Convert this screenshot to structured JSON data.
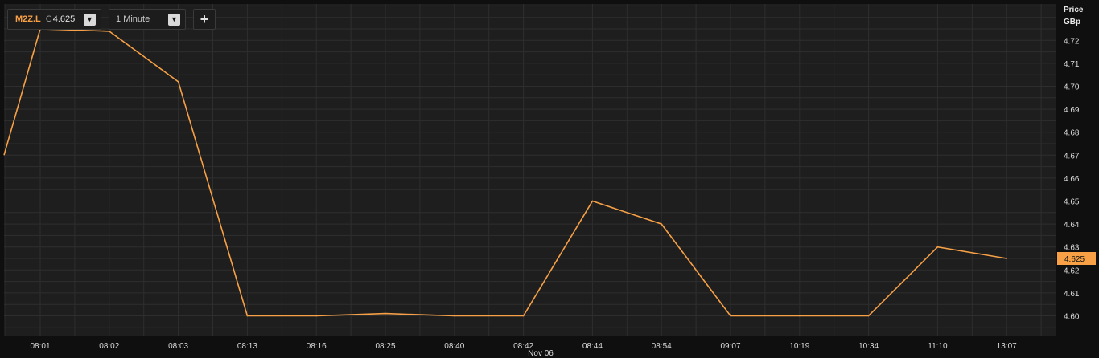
{
  "toolbar": {
    "symbol": "M2Z.L",
    "close_prefix": "C",
    "close_value": "4.625",
    "interval": "1 Minute",
    "dropdown_glyph": "▼",
    "add_glyph": "+"
  },
  "colors": {
    "background": "#0f0f0f",
    "plot_background": "#1e1e1e",
    "grid": "#2e2e2e",
    "line": "#f7a046",
    "price_tag": "#f7a046",
    "text": "#dcdcdc"
  },
  "chart_data": {
    "type": "line",
    "title": "",
    "xlabel": "",
    "ylabel_line1": "Price",
    "ylabel_line2": "GBp",
    "date_label": "Nov 06",
    "ylim": [
      4.595,
      4.735
    ],
    "yticks": [
      "4.60",
      "4.61",
      "4.62",
      "4.63",
      "4.64",
      "4.65",
      "4.66",
      "4.67",
      "4.68",
      "4.69",
      "4.70",
      "4.71",
      "4.72"
    ],
    "categories": [
      "08:01",
      "08:02",
      "08:03",
      "08:13",
      "08:16",
      "08:25",
      "08:40",
      "08:42",
      "08:44",
      "08:54",
      "09:07",
      "10:19",
      "10:34",
      "11:10",
      "13:07"
    ],
    "series": [
      {
        "values": [
          4.725,
          4.724,
          4.702,
          4.6,
          4.6,
          4.601,
          4.6,
          4.6,
          4.65,
          4.64,
          4.6,
          4.6,
          4.6,
          4.63,
          4.625
        ],
        "start_value": 4.67
      }
    ],
    "last_price_label": "4.625",
    "last_price_value": 4.625,
    "grid": true,
    "axis_position": "right"
  }
}
